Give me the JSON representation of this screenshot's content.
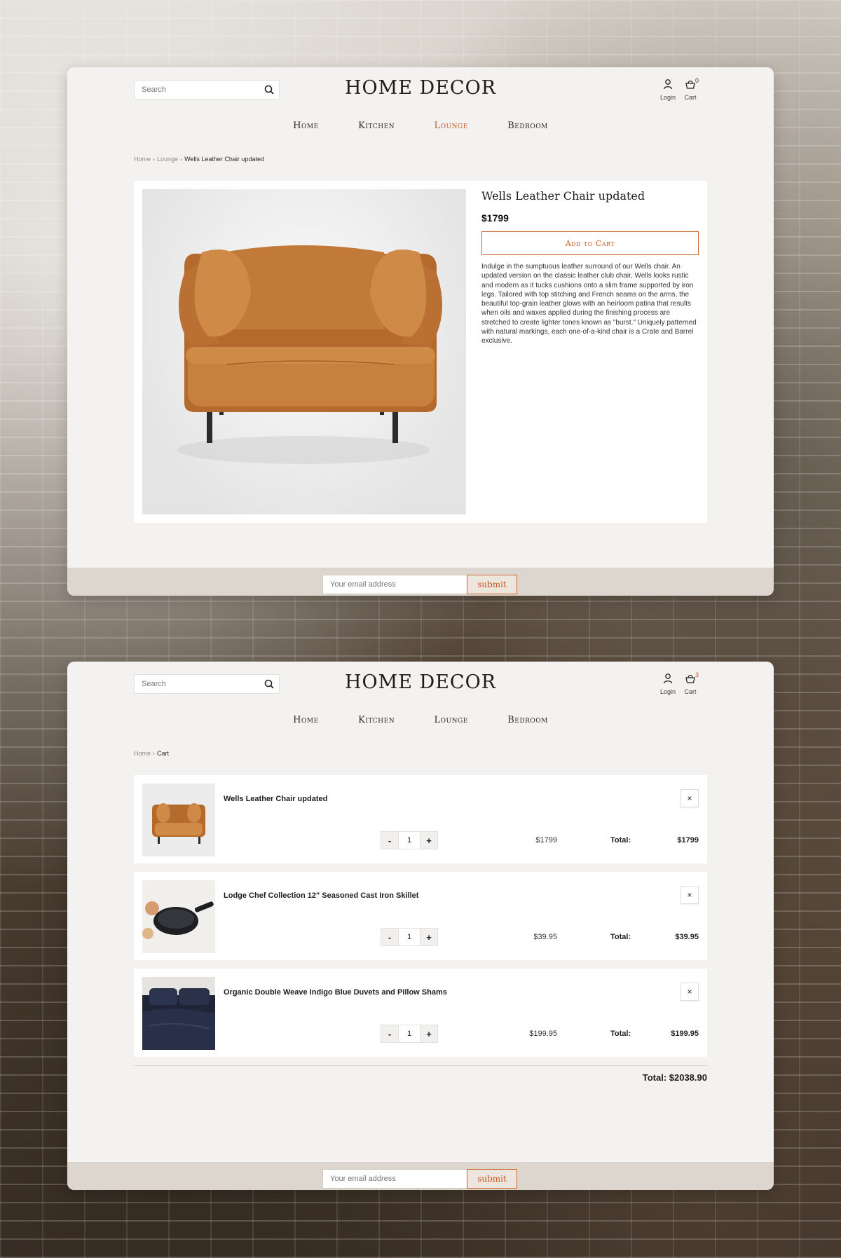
{
  "site": {
    "logo": "HOME DECOR",
    "search_placeholder": "Search",
    "login_label": "Login",
    "cart_label": "Cart",
    "nav": [
      "Home",
      "Kitchen",
      "Lounge",
      "Bedroom"
    ],
    "email_placeholder": "Your email address",
    "submit_label": "submit",
    "accent_color": "#c85a20"
  },
  "product_page": {
    "cart_count": "0",
    "active_nav": "Lounge",
    "breadcrumb": [
      "Home",
      "Lounge",
      "Wells Leather Chair updated"
    ],
    "product": {
      "title": "Wells Leather Chair updated",
      "price": "$1799",
      "add_to_cart": "Add to Cart",
      "description": "Indulge in the sumptuous leather surround of our Wells chair. An updated version on the classic leather club chair, Wells looks rustic and modern as it tucks cushions onto a slim frame supported by iron legs. Tailored with top stitching and French seams on the arms, the beautiful top-grain leather glows with an heirloom patina that results when oils and waxes applied during the finishing process are stretched to create lighter tones known as \"burst.\" Uniquely patterned with natural markings, each one-of-a-kind chair is a Crate and Barrel exclusive."
    }
  },
  "cart_page": {
    "cart_count": "3",
    "breadcrumb": [
      "Home",
      "Cart"
    ],
    "total_label": "Total:",
    "items": [
      {
        "name": "Wells Leather Chair updated",
        "qty": "1",
        "price": "$1799",
        "total": "$1799",
        "icon": "leather-armchair"
      },
      {
        "name": "Lodge Chef Collection 12\" Seasoned Cast Iron Skillet",
        "qty": "1",
        "price": "$39.95",
        "total": "$39.95",
        "icon": "cast-iron-skillet"
      },
      {
        "name": "Organic Double Weave Indigo Blue Duvets and Pillow Shams",
        "qty": "1",
        "price": "$199.95",
        "total": "$199.95",
        "icon": "indigo-bedding"
      }
    ],
    "grand_total": "Total: $2038.90",
    "remove_symbol": "×",
    "minus": "-",
    "plus": "+"
  }
}
